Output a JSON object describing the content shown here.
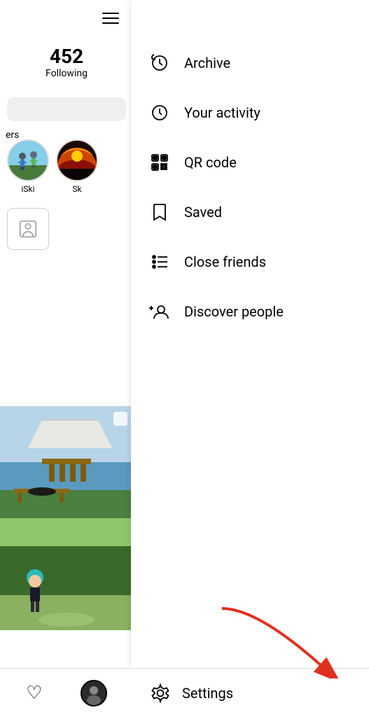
{
  "left_panel": {
    "following": {
      "number": "452",
      "label": "Following"
    },
    "followers_label": "ers",
    "stories": [
      {
        "label": "iSki",
        "type": "iski"
      },
      {
        "label": "Sk",
        "type": "sk"
      }
    ]
  },
  "menu": {
    "items": [
      {
        "id": "archive",
        "label": "Archive",
        "icon": "archive"
      },
      {
        "id": "activity",
        "label": "Your activity",
        "icon": "activity"
      },
      {
        "id": "qrcode",
        "label": "QR code",
        "icon": "qr"
      },
      {
        "id": "saved",
        "label": "Saved",
        "icon": "bookmark"
      },
      {
        "id": "close-friends",
        "label": "Close friends",
        "icon": "close-friends"
      },
      {
        "id": "discover",
        "label": "Discover people",
        "icon": "discover"
      }
    ]
  },
  "bottom_bar": {
    "settings_label": "Settings",
    "settings_icon": "gear"
  },
  "colors": {
    "accent_red": "#e03020",
    "text_primary": "#000000",
    "bg": "#ffffff",
    "divider": "#dbdbdb"
  }
}
